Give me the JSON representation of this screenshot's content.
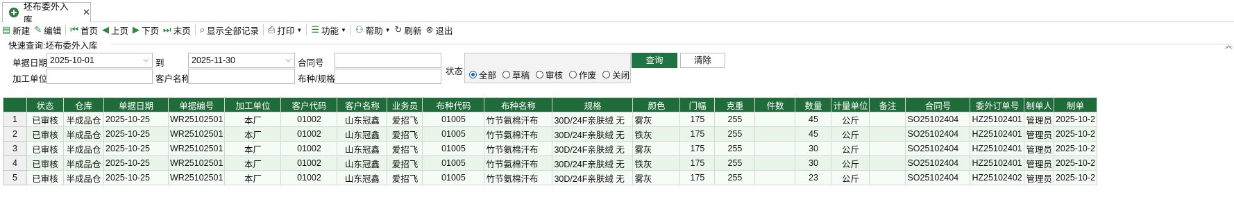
{
  "tab": {
    "title": "坯布委外入库",
    "close": "✕"
  },
  "toolbar": [
    {
      "name": "new-button",
      "icon": "▤",
      "label": "新建",
      "cls": "ic-green"
    },
    {
      "name": "edit-button",
      "icon": "✎",
      "label": "编辑",
      "cls": "ic-green"
    },
    {
      "sep": true
    },
    {
      "name": "first-page-button",
      "icon": "⏮",
      "label": "首页",
      "cls": "ic-green"
    },
    {
      "name": "prev-page-button",
      "icon": "◀",
      "label": "上页",
      "cls": "ic-green"
    },
    {
      "name": "next-page-button",
      "icon": "▶",
      "label": "下页",
      "cls": "ic-green"
    },
    {
      "name": "last-page-button",
      "icon": "⏭",
      "label": "末页",
      "cls": "ic-green"
    },
    {
      "sep": true
    },
    {
      "name": "show-all-records-button",
      "icon": "⌕",
      "label": "显示全部记录",
      "cls": "ic-dark"
    },
    {
      "sep": true
    },
    {
      "name": "print-button",
      "icon": "⎙",
      "label": "打印",
      "cls": "ic-dark",
      "dropdown": true
    },
    {
      "sep": true
    },
    {
      "name": "function-menu-button",
      "icon": "☰",
      "label": "功能",
      "cls": "ic-green",
      "dropdown": true
    },
    {
      "sep": true
    },
    {
      "name": "help-menu-button",
      "icon": "⚇",
      "label": "帮助",
      "cls": "ic-green",
      "dropdown": true
    },
    {
      "name": "refresh-button",
      "icon": "↻",
      "label": "刷新",
      "cls": "ic-dark"
    },
    {
      "name": "exit-button",
      "icon": "⊗",
      "label": "退出",
      "cls": "ic-dark"
    }
  ],
  "query": {
    "title": "快速查询:坯布委外入库",
    "date_label": "单据日期",
    "date_from": "2025-10-01",
    "to_label": "到",
    "date_to": "2025-11-30",
    "contract_label": "合同号",
    "contract_value": "",
    "processor_label": "加工单位",
    "processor_value": "",
    "customer_label": "客户名称",
    "customer_value": "",
    "fabric_label": "布种/规格",
    "fabric_value": "",
    "status_label": "状态",
    "status_options": [
      {
        "label": "全部",
        "selected": true
      },
      {
        "label": "草稿",
        "selected": false
      },
      {
        "label": "审核",
        "selected": false
      },
      {
        "label": "作废",
        "selected": false
      },
      {
        "label": "关闭",
        "selected": false
      }
    ],
    "query_button": "查询",
    "clear_button": "清除"
  },
  "grid": {
    "columns": [
      "状态",
      "仓库",
      "单据日期",
      "单据编号",
      "加工单位",
      "客户代码",
      "客户名称",
      "业务员",
      "布种代码",
      "布种名称",
      "规格",
      "颜色",
      "门幅",
      "克重",
      "件数",
      "数量",
      "计量单位",
      "备注",
      "合同号",
      "委外订单号",
      "制单人",
      "制单"
    ],
    "rows": [
      [
        "1",
        "已审核",
        "半成品仓",
        "2025-10-25",
        "WR25102501",
        "本厂",
        "01002",
        "山东冠鑫",
        "爱招飞",
        "01005",
        "竹节氨棉汗布",
        "30D/24F亲肤绒 无",
        "雾灰",
        "175",
        "255",
        "",
        "45",
        "公斤",
        "",
        "SO25102404",
        "HZ25102401",
        "管理员",
        "2025-10-2"
      ],
      [
        "2",
        "已审核",
        "半成品仓",
        "2025-10-25",
        "WR25102501",
        "本厂",
        "01002",
        "山东冠鑫",
        "爱招飞",
        "01005",
        "竹节氨棉汗布",
        "30D/24F亲肤绒 无",
        "铁灰",
        "175",
        "255",
        "",
        "45",
        "公斤",
        "",
        "SO25102404",
        "HZ25102401",
        "管理员",
        "2025-10-2"
      ],
      [
        "3",
        "已审核",
        "半成品仓",
        "2025-10-25",
        "WR25102501",
        "本厂",
        "01002",
        "山东冠鑫",
        "爱招飞",
        "01005",
        "竹节氨棉汗布",
        "30D/24F亲肤绒 无",
        "雾灰",
        "175",
        "255",
        "",
        "30",
        "公斤",
        "",
        "SO25102404",
        "HZ25102401",
        "管理员",
        "2025-10-2"
      ],
      [
        "4",
        "已审核",
        "半成品仓",
        "2025-10-25",
        "WR25102501",
        "本厂",
        "01002",
        "山东冠鑫",
        "爱招飞",
        "01005",
        "竹节氨棉汗布",
        "30D/24F亲肤绒 无",
        "铁灰",
        "175",
        "255",
        "",
        "30",
        "公斤",
        "",
        "SO25102404",
        "HZ25102401",
        "管理员",
        "2025-10-2"
      ],
      [
        "5",
        "已审核",
        "半成品仓",
        "2025-10-25",
        "WR25102501",
        "本厂",
        "01002",
        "山东冠鑫",
        "爱招飞",
        "01005",
        "竹节氨棉汗布",
        "30D/24F亲肤绒 无",
        "雾灰",
        "175",
        "255",
        "",
        "23",
        "公斤",
        "",
        "SO25102404",
        "HZ25102402",
        "管理员",
        "2025-10-2"
      ]
    ]
  }
}
